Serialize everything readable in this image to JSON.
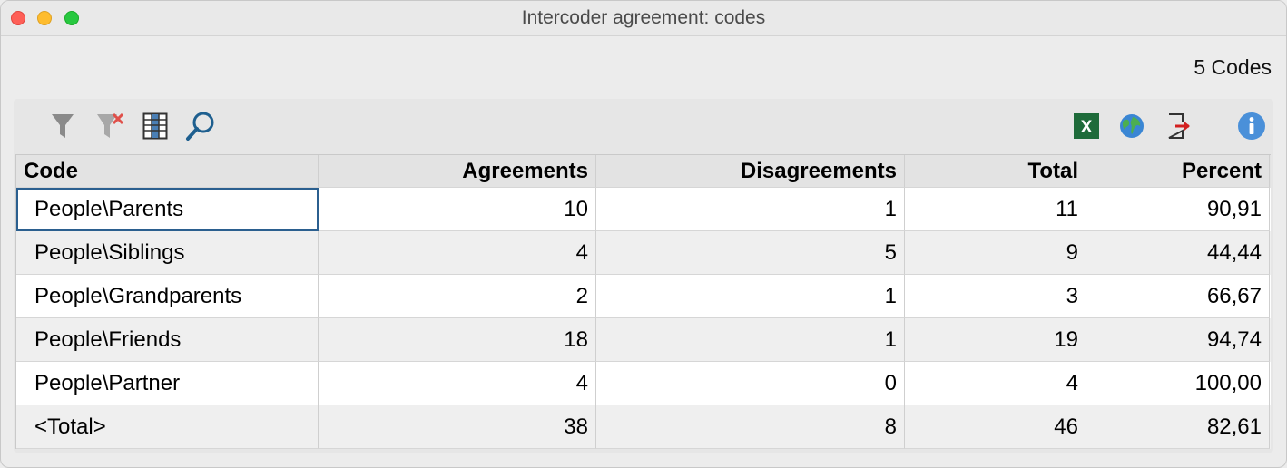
{
  "window": {
    "title": "Intercoder agreement: codes"
  },
  "summary": {
    "count_text": "5 Codes"
  },
  "toolbar": {
    "icons": [
      "filter-icon",
      "clear-filter-icon",
      "columns-icon",
      "search-icon",
      "excel-export-icon",
      "web-export-icon",
      "export-icon",
      "info-icon"
    ],
    "colors": {
      "excel": "#1e6b3a",
      "info": "#4a90d9",
      "search": "#1e5f8f",
      "export": "#d32020"
    }
  },
  "table": {
    "columns": [
      "Code",
      "Agreements",
      "Disagreements",
      "Total",
      "Percent"
    ],
    "rows": [
      [
        "People\\Parents",
        "10",
        "1",
        "11",
        "90,91"
      ],
      [
        "People\\Siblings",
        "4",
        "5",
        "9",
        "44,44"
      ],
      [
        "People\\Grandparents",
        "2",
        "1",
        "3",
        "66,67"
      ],
      [
        "People\\Friends",
        "18",
        "1",
        "19",
        "94,74"
      ],
      [
        "People\\Partner",
        "4",
        "0",
        "4",
        "100,00"
      ],
      [
        "<Total>",
        "38",
        "8",
        "46",
        "82,61"
      ]
    ]
  }
}
